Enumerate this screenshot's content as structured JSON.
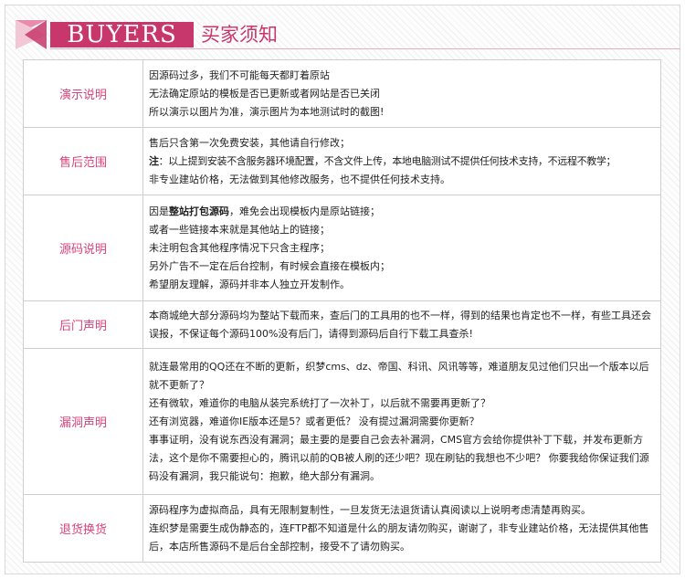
{
  "header": {
    "badge": "BUYERS",
    "title": "买家须知",
    "accent_color": "#c7376b"
  },
  "rows": [
    {
      "label": "演示说明",
      "lines": [
        "因源码过多，我们不可能每天都盯着原站",
        "无法确定原站的模板是否已更新或者网站是否已关闭",
        "所以演示以图片为准，演示图片为本地测试时的截图!"
      ]
    },
    {
      "label": "售后范围",
      "lines": [
        "售后只含第一次免费安装，其他请自行修改；",
        "注：以上提到安装不含服务器环境配置，不含文件上传，本地电脑测试不提供任何技术支持，不远程不教学；",
        "非专业建站价格，无法做到其他修改服务，也不提供任何技术支持。"
      ],
      "note_prefix": "注"
    },
    {
      "label": "源码说明",
      "line1_prefix": "因是",
      "line1_bold": "整站打包源码",
      "line1_suffix": "，难免会出现模板内是原站链接；",
      "lines": [
        "或者一些链接本来就是其他站上的链接；",
        "未注明包含其他程序情况下只含主程序；",
        "另外广告不一定在后台控制，有时候会直接在模板内；",
        "希望朋友理解，源码并非本人独立开发制作。"
      ]
    },
    {
      "label": "后门声明",
      "lines": [
        "本商城绝大部分源码均为整站下载而来，查后门的工具用的也不一样，得到的结果也肯定也不一样，有些工具还会误报，不保证每个源码100%没有后门，请得到源码后自行下载工具查杀!"
      ]
    },
    {
      "label": "漏洞声明",
      "lines": [
        "就连最常用的QQ还在不断的更新，织梦cms、dz、帝国、科讯、风讯等等，难道朋友见过他们只出一个版本以后就不更新了？",
        "还有微软，难道你的电脑从装完系统打了一次补丁，以后就不需要再更新了？",
        "还有浏览器，难道你IE版本还是5？或者更低？ 没有提过漏洞需要你更新？",
        "事事证明，没有说东西没有漏洞；最主要的是要自己会去补漏洞，CMS官方会给你提供补丁下载，并发布更新方法，这个是你不需要担心的，腾讯以前的QB被人刷的还少吧？现在刷钻的我想也不少吧？ 你要我给你保证我们源码没有漏洞，我只能说句：抱歉，绝大部分有漏洞。"
      ]
    },
    {
      "label": "退货换货",
      "lines": [
        "源码程序为虚拟商品，具有无限制复制性，一旦发货无法退货请认真阅读以上说明考虑清楚再购买。",
        "连织梦是需要生成伪静态的，连FTP都不知道是什么的朋友请勿购买，谢谢了，非专业建站价格，无法提供其他售后，本店所售源码不是后台全部控制，接受不了请勿购买。"
      ]
    }
  ]
}
